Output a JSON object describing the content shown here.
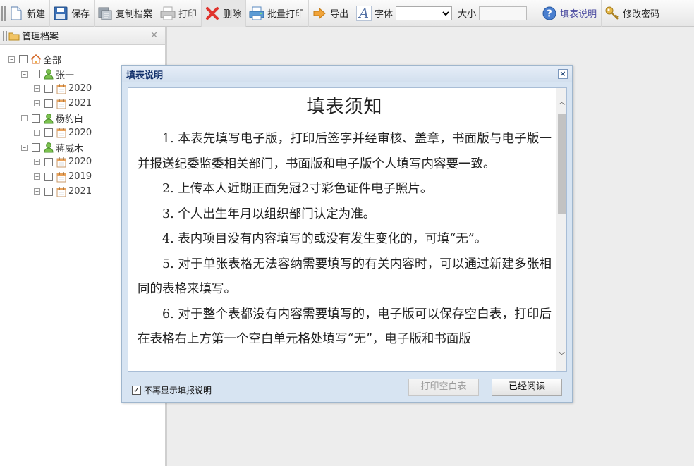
{
  "toolbar": {
    "new_label": "新建",
    "save_label": "保存",
    "copy_label": "复制档案",
    "print_label": "打印",
    "delete_label": "删除",
    "batch_print_label": "批量打印",
    "export_label": "导出",
    "font_label": "字体",
    "font_value": "",
    "size_label": "大小",
    "size_value": "",
    "help_label": "填表说明",
    "change_password_label": "修改密码"
  },
  "panel": {
    "title": "管理档案"
  },
  "tree": {
    "root": "全部",
    "people": [
      {
        "name": "张一",
        "years": [
          "2020",
          "2021"
        ]
      },
      {
        "name": "杨豹白",
        "years": [
          "2020"
        ]
      },
      {
        "name": "蒋威木",
        "years": [
          "2020",
          "2019",
          "2021"
        ]
      }
    ]
  },
  "dialog": {
    "title": "填表说明",
    "heading": "填表须知",
    "paragraphs": [
      "1. 本表先填写电子版，打印后签字并经审核、盖章，书面版与电子版一并报送纪委监委相关部门，书面版和电子版个人填写内容要一致。",
      "2. 上传本人近期正面免冠2寸彩色证件电子照片。",
      "3. 个人出生年月以组织部门认定为准。",
      "4. 表内项目没有内容填写的或没有发生变化的，可填“无”。",
      "5. 对于单张表格无法容纳需要填写的有关内容时，可以通过新建多张相同的表格来填写。",
      "6. 对于整个表都没有内容需要填写的，电子版可以保存空白表，打印后在表格右上方第一个空白单元格处填写“无”，电子版和书面版"
    ],
    "dont_show_label": "不再显示填报说明",
    "dont_show_checked": true,
    "print_blank_label": "打印空白表",
    "read_label": "已经阅读"
  }
}
